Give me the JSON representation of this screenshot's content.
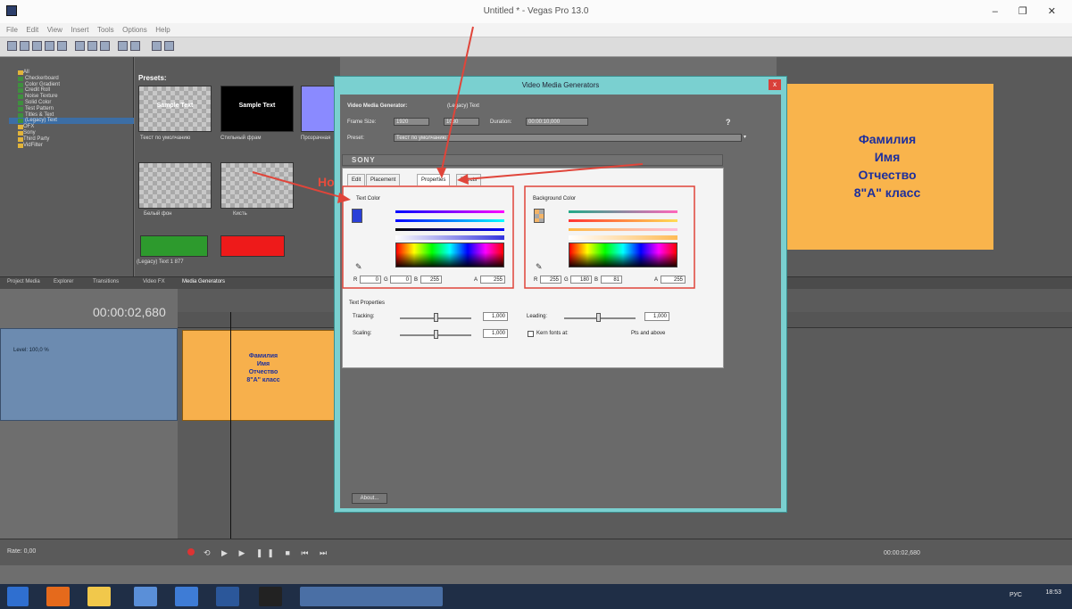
{
  "window": {
    "title": "Untitled * - Vegas Pro 13.0",
    "controls": "– ❐ ✕"
  },
  "menu": [
    "File",
    "Edit",
    "View",
    "Insert",
    "Tools",
    "Options",
    "Help"
  ],
  "explorer": {
    "tree": [
      "All",
      "Checkerboard",
      "Color Gradient",
      "Credit Roll",
      "Noise Texture",
      "Solid Color",
      "Test Pattern",
      "Titles & Text",
      "(Legacy) Text",
      "OFX",
      "Sony",
      "Third Party",
      "VidFilter"
    ]
  },
  "presets": {
    "header": "Presets:",
    "thumbs": [
      {
        "label": "Текст по умолчанию",
        "text": "Sample Text"
      },
      {
        "label": "Стильный фрам",
        "text": "Sample Text"
      },
      {
        "label": "Прозрачная"
      },
      {
        "label": "Белый фон"
      },
      {
        "label": "Кисть"
      },
      {
        "label": "(Legacy) Text 1 877"
      }
    ]
  },
  "preview": {
    "lines": [
      "Фамилия",
      "Имя",
      "Отчество",
      "8\"А\" класс"
    ]
  },
  "tabs": [
    "Project Media",
    "Explorer",
    "Transitions",
    "Video FX",
    "Media Generators"
  ],
  "timeline": {
    "timecode": "00:00:02,680",
    "level": "Level: 100,0 %",
    "clip_lines": [
      "Фамилия",
      "Имя",
      "Отчество",
      "8\"А\" класс"
    ]
  },
  "bottom": {
    "rate": "Rate: 0,00",
    "time": "00:00:02,680"
  },
  "dialog": {
    "title": "Video Media Generators",
    "close": "x",
    "generator_label": "Video Media Generator:",
    "generator_value": "(Legacy) Text",
    "frame_size_label": "Frame Size:",
    "frame_w": "1920",
    "frame_h": "1080",
    "duration_label": "Duration:",
    "duration_value": "00:00:10,000",
    "preset_label": "Preset:",
    "preset_value": "Текст по умолчанию",
    "sony": "SONY",
    "tabs": [
      "Edit",
      "Placement",
      "Properties",
      "Effects"
    ],
    "text_color_label": "Text Color",
    "bg_color_label": "Background Color",
    "text_rgb": {
      "r_label": "R",
      "r": "0",
      "g_label": "G",
      "g": "0",
      "b_label": "B",
      "b": "255",
      "a_label": "A",
      "a": "255"
    },
    "bg_rgb": {
      "r_label": "R",
      "r": "255",
      "g_label": "G",
      "g": "180",
      "b_label": "B",
      "b": "81",
      "a_label": "A",
      "a": "255"
    },
    "text_props_label": "Text Properties",
    "tracking_label": "Tracking:",
    "tracking_value": "1,000",
    "scaling_label": "Scaling:",
    "scaling_value": "1,000",
    "leading_label": "Leading:",
    "leading_value": "1,000",
    "kern_label": "Kern fonts at:",
    "kern_suffix": "Pts and above",
    "about_btn": "About..."
  },
  "taskbar": {
    "clock_time": "18:53",
    "clock_lang": "РУС"
  },
  "hello": "Но"
}
